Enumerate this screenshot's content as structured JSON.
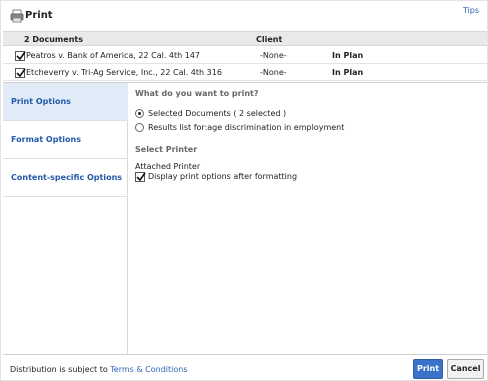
{
  "dialog": {
    "title": "Print",
    "tips_link": "Tips",
    "icon": "printer-icon"
  },
  "documents": {
    "header_count": "2 Documents",
    "header_client": "Client",
    "rows": [
      {
        "name": "Peatros v. Bank of America, 22 Cal. 4th 147",
        "client": "-None-",
        "plan": "In Plan",
        "checked": true
      },
      {
        "name": "Etcheverry v. Tri-Ag Service, Inc., 22 Cal. 4th 316",
        "client": "-None-",
        "plan": "In Plan",
        "checked": true
      }
    ]
  },
  "sidebar": {
    "tabs": [
      {
        "label": "Print Options",
        "active": true
      },
      {
        "label": "Format Options",
        "active": false
      },
      {
        "label": "Content-specific Options",
        "active": false
      }
    ]
  },
  "print_options": {
    "question": "What do you want to print?",
    "options": [
      {
        "label": "Selected Documents ( 2 selected )",
        "selected": true
      },
      {
        "label": "Results list for:age discrimination in employment",
        "selected": false
      }
    ],
    "printer_section_title": "Select Printer",
    "printer_name": "Attached Printer",
    "display_options_label": "Display print options after formatting",
    "display_options_checked": true
  },
  "footer": {
    "distribution_text": "Distribution is subject to",
    "terms_link": "Terms & Conditions",
    "print_button": "Print",
    "cancel_button": "Cancel"
  },
  "colors": {
    "link": "#2f63b8",
    "tab_text": "#2459a8",
    "active_tab_bg": "#e2ecf8",
    "primary_button": "#3a73c9"
  }
}
